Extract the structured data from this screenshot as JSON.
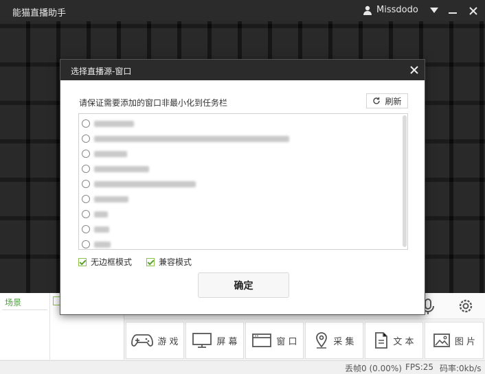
{
  "app": {
    "title": "能猫直播助手",
    "username": "Missdodo"
  },
  "scene": {
    "label": "场景"
  },
  "sources": [
    {
      "label": "游 戏",
      "icon": "gamepad-icon"
    },
    {
      "label": "屏 幕",
      "icon": "monitor-icon"
    },
    {
      "label": "窗 口",
      "icon": "window-icon"
    },
    {
      "label": "采 集",
      "icon": "location-pin-icon"
    },
    {
      "label": "文 本",
      "icon": "document-icon"
    },
    {
      "label": "图 片",
      "icon": "image-icon"
    }
  ],
  "status": {
    "dropped": "丢帧0 (0.00%)",
    "fps": "FPS:25",
    "bitrate": "码率:0kb/s"
  },
  "dialog": {
    "title": "选择直播源-窗口",
    "hint": "请保证需要添加的窗口非最小化到任务栏",
    "refresh_label": "刷新",
    "borderless_label": "无边框模式",
    "compat_label": "兼容模式",
    "confirm_label": "确定",
    "borderless_checked": true,
    "compat_checked": true
  },
  "colors": {
    "accent_green": "#5aa02c",
    "titlebar": "#2b2b2b"
  }
}
